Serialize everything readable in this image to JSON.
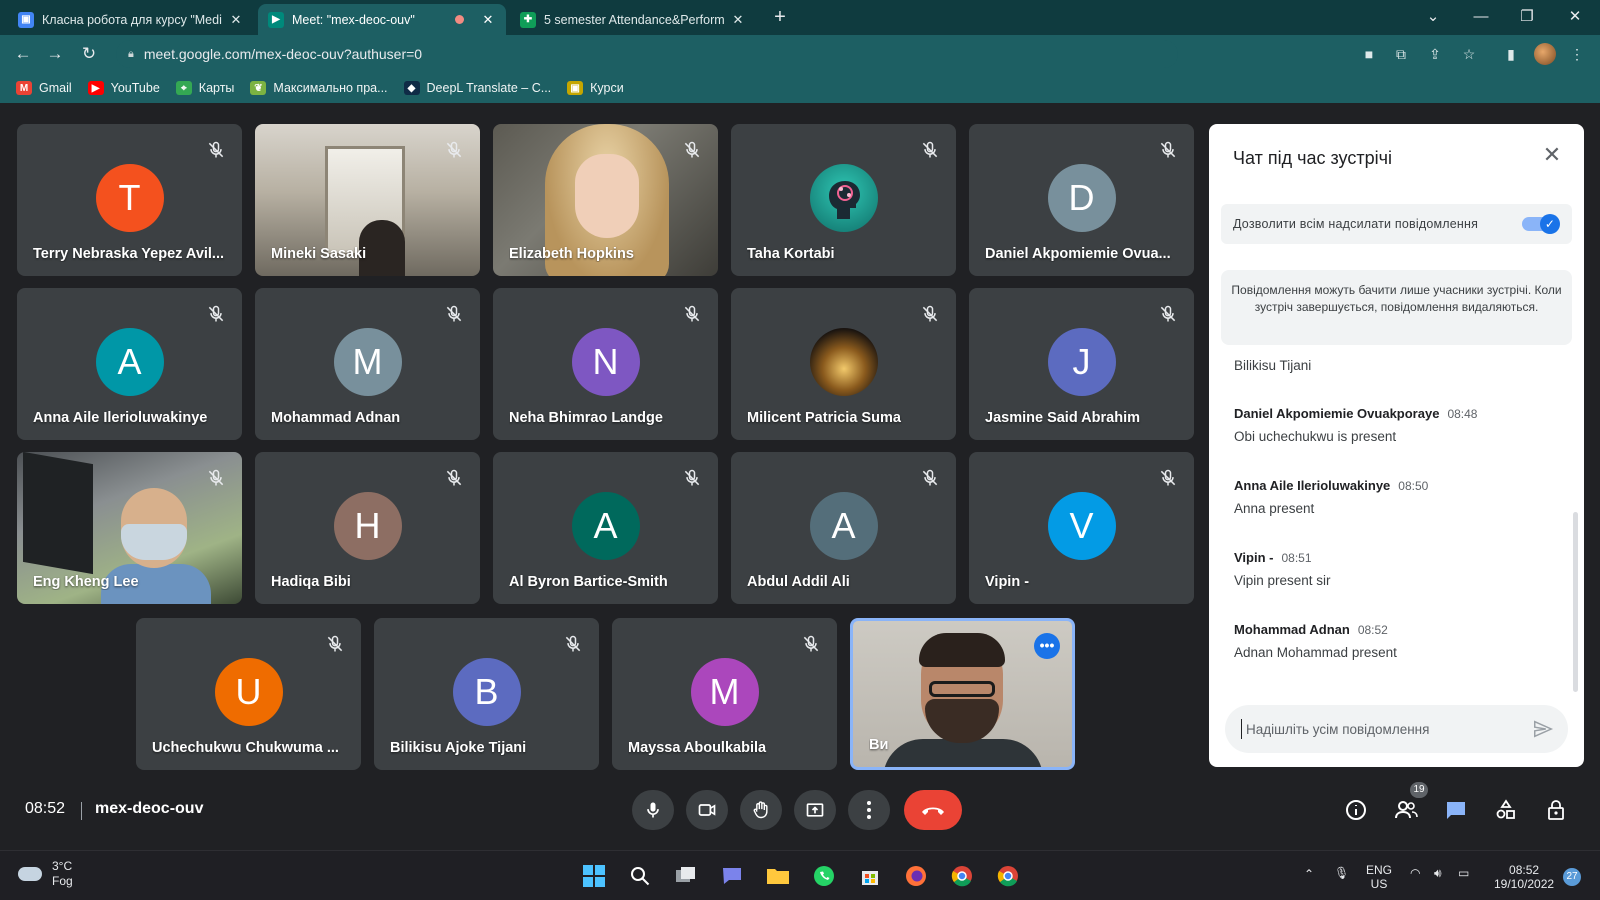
{
  "browser": {
    "tabs": [
      {
        "title": "Класна робота для курсу \"Media",
        "active": false,
        "favicon_color": "#4285f4"
      },
      {
        "title": "Meet: \"mex-deoc-ouv\"",
        "active": true,
        "favicon_color": "#00897b"
      },
      {
        "title": "5 semester Attendance&Perform",
        "active": false,
        "favicon_color": "#0f9d58"
      }
    ],
    "url": "meet.google.com/mex-deoc-ouv?authuser=0",
    "bookmarks": [
      {
        "label": "Gmail",
        "icon": "gmail-icon",
        "color": "#ea4335",
        "glyph": "M"
      },
      {
        "label": "YouTube",
        "icon": "youtube-icon",
        "color": "#ff0000",
        "glyph": "▶"
      },
      {
        "label": "Карты",
        "icon": "maps-icon",
        "color": "#34a853",
        "glyph": "⌖"
      },
      {
        "label": "Максимально пра...",
        "icon": "leaf-icon",
        "color": "#7cb342",
        "glyph": "❦"
      },
      {
        "label": "DeepL Translate – C...",
        "icon": "deepl-icon",
        "color": "#0f2b46",
        "glyph": "◆"
      },
      {
        "label": "Курси",
        "icon": "folder-icon",
        "color": "#c5a600",
        "glyph": "▣"
      }
    ]
  },
  "participants": [
    {
      "name": "Terry Nebraska Yepez Avil...",
      "initial": "T",
      "color": "#f4511e",
      "type": "avatar"
    },
    {
      "name": "Mineki Sasaki",
      "type": "photo-hall"
    },
    {
      "name": "Elizabeth Hopkins",
      "type": "photo-blonde"
    },
    {
      "name": "Taha Kortabi",
      "type": "img-brain"
    },
    {
      "name": "Daniel Akpomiemie Ovua...",
      "initial": "D",
      "color": "#78909c",
      "type": "avatar"
    },
    {
      "name": "Anna Aile Ilerioluwakinye",
      "initial": "A",
      "color": "#0097a7",
      "type": "avatar"
    },
    {
      "name": "Mohammad Adnan",
      "initial": "M",
      "color": "#78909c",
      "type": "avatar"
    },
    {
      "name": "Neha Bhimrao Landge",
      "initial": "N",
      "color": "#7e57c2",
      "type": "avatar"
    },
    {
      "name": "Milicent Patricia Suma",
      "type": "img-fountain"
    },
    {
      "name": "Jasmine Said Abrahim",
      "initial": "J",
      "color": "#5c6bc0",
      "type": "avatar"
    },
    {
      "name": "Eng Kheng Lee",
      "type": "photo-mask"
    },
    {
      "name": "Hadiqa Bibi",
      "initial": "H",
      "color": "#8d6e63",
      "type": "avatar"
    },
    {
      "name": "Al Byron Bartice-Smith",
      "initial": "A",
      "color": "#00695c",
      "type": "avatar"
    },
    {
      "name": "Abdul Addil Ali",
      "initial": "A",
      "color": "#546e7a",
      "type": "avatar"
    },
    {
      "name": "Vipin -",
      "initial": "V",
      "color": "#039be5",
      "type": "avatar"
    },
    {
      "name": "Uchechukwu Chukwuma ...",
      "initial": "U",
      "color": "#ef6c00",
      "type": "avatar"
    },
    {
      "name": "Bilikisu Ajoke Tijani",
      "initial": "B",
      "color": "#5c6bc0",
      "type": "avatar"
    },
    {
      "name": "Mayssa Aboulkabila",
      "initial": "M",
      "color": "#ab47bc",
      "type": "avatar"
    },
    {
      "name": "Ви",
      "type": "photo-self",
      "self": true
    }
  ],
  "chat": {
    "title": "Чат під час зустрічі",
    "permission_label": "Дозволити всім надсилати повідомлення",
    "permission_on": true,
    "info": "Повідомлення можуть бачити лише учасники зустрічі. Коли зустріч завершується, повідомлення видаляються.",
    "continued_sender": "Bilikisu Tijani",
    "messages": [
      {
        "sender": "Daniel Akpomiemie Ovuakporaye",
        "time": "08:48",
        "text": "Obi uchechukwu is present"
      },
      {
        "sender": "Anna Aile Ilerioluwakinye",
        "time": "08:50",
        "text": "Anna present"
      },
      {
        "sender": "Vipin -",
        "time": "08:51",
        "text": "Vipin present sir"
      },
      {
        "sender": "Mohammad Adnan",
        "time": "08:52",
        "text": "Adnan Mohammad present"
      }
    ],
    "input_placeholder": "Надішліть усім повідомлення"
  },
  "meeting": {
    "time": "08:52",
    "code": "mex-deoc-ouv",
    "people_count": "19"
  },
  "taskbar": {
    "weather_temp": "3°C",
    "weather_desc": "Fog",
    "lang_top": "ENG",
    "lang_bottom": "US",
    "clock_time": "08:52",
    "clock_date": "19/10/2022",
    "notifications": "27"
  }
}
